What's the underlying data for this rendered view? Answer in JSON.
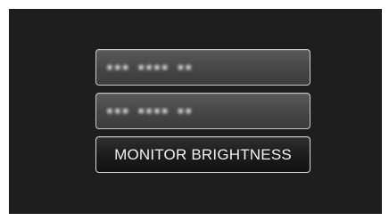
{
  "menu": {
    "items": [
      {
        "label": "▪▪▪ ▪▪▪▪ ▪▪",
        "blurred": true
      },
      {
        "label": "▪▪▪ ▪▪▪▪ ▪▪",
        "blurred": true
      },
      {
        "label": "MONITOR BRIGHTNESS",
        "blurred": false,
        "selected": true
      }
    ]
  },
  "colors": {
    "screen_background": "#1f1e1e",
    "item_border": "#c9c9c9",
    "selected_item_background": "#1b1b1b",
    "text": "#f2f2f2"
  }
}
